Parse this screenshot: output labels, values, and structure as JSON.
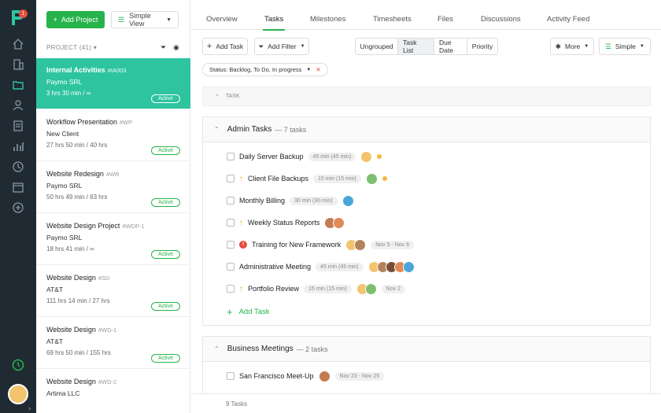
{
  "rail": {
    "logo_badge": "1",
    "icons": [
      "home-icon",
      "building-icon",
      "folder-icon",
      "user-icon",
      "invoice-icon",
      "reports-icon",
      "clock-icon",
      "calendar-icon",
      "add-circle-icon"
    ],
    "timer_icon": "timer-icon"
  },
  "projects_panel": {
    "add_project_label": "Add Project",
    "view_label": "Simple View",
    "header": "PROJECT (41)",
    "items": [
      {
        "name": "Internal Activities",
        "code": "#IA003",
        "client": "Paymo SRL",
        "time": "3 hrs 30 min / ∞",
        "status": "Active",
        "active": true
      },
      {
        "name": "Workflow Presentation",
        "code": "#WP",
        "client": "New Client",
        "time": "27 hrs 50 min / 40 hrs",
        "status": "Active",
        "active": false
      },
      {
        "name": "Website Redesign",
        "code": "#WR",
        "client": "Paymo SRL",
        "time": "50 hrs 49 min / 63 hrs",
        "status": "Active",
        "active": false
      },
      {
        "name": "Website Design Project",
        "code": "#WDP-1",
        "client": "Paymo SRL",
        "time": "18 hrs 41 min / ∞",
        "status": "Active",
        "active": false
      },
      {
        "name": "Website Design",
        "code": "#SD",
        "client": "AT&T",
        "time": "111 hrs 14 min / 27 hrs",
        "status": "Active",
        "active": false
      },
      {
        "name": "Website Design",
        "code": "#WD-1",
        "client": "AT&T",
        "time": "69 hrs 50 min / 155 hrs",
        "status": "Active",
        "active": false
      },
      {
        "name": "Website Design",
        "code": "#WD-2",
        "client": "Artima LLC",
        "time": "",
        "status": "",
        "active": false
      }
    ]
  },
  "tabs": [
    "Overview",
    "Tasks",
    "Milestones",
    "Timesheets",
    "Files",
    "Discussions",
    "Activity Feed"
  ],
  "active_tab": "Tasks",
  "toolbar": {
    "add_task": "Add Task",
    "add_filter": "Add Filter",
    "segments": [
      "Ungrouped",
      "Task List",
      "Due Date",
      "Priority"
    ],
    "active_segment": "Task List",
    "more": "More",
    "simple": "Simple"
  },
  "filter_chip": {
    "label": "Status: Backlog, To Do, In progress"
  },
  "task_header": "TASK",
  "groups": [
    {
      "name": "Admin Tasks",
      "count": "— 7 tasks",
      "tasks": [
        {
          "name": "Daily Server Backup",
          "pill": "45 min (45 min)",
          "prio": "",
          "avatars": [
            "#f2c46d"
          ],
          "dot": true
        },
        {
          "name": "Client File Backups",
          "pill": "15 min (15 min)",
          "prio": "↑",
          "avatars": [
            "#7dbf6e"
          ],
          "dot": true
        },
        {
          "name": "Monthly Billing",
          "pill": "30 min (30 min)",
          "prio": "",
          "avatars": [
            "#4aa6d8"
          ],
          "dot": false
        },
        {
          "name": "Weekly Status Reports",
          "pill": "",
          "prio": "↑",
          "avatars": [
            "#c47b52",
            "#e08a5a"
          ],
          "dot": false
        },
        {
          "name": "Training for New Framework",
          "pill": "Nov 5 - Nov 6",
          "prio": "!",
          "avatars": [
            "#f2c46d",
            "#b5835a"
          ],
          "dot": false
        },
        {
          "name": "Administrative Meeting",
          "pill": "45 min (45 min)",
          "prio": "",
          "avatars": [
            "#f2c46d",
            "#b5835a",
            "#7a4e35",
            "#e08a5a",
            "#4aa6d8"
          ],
          "dot": false
        },
        {
          "name": "Portfolio Review",
          "pill": "15 min (15 min)",
          "prio": "↑",
          "avatars": [
            "#f2c46d",
            "#7dbf6e"
          ],
          "pill2": "Nov 2",
          "dot": false
        }
      ],
      "add_task": "Add Task"
    },
    {
      "name": "Business Meetings",
      "count": "— 2 tasks",
      "tasks": [
        {
          "name": "San Francisco Meet-Up",
          "pill": "Nov 23 - Nov 25",
          "prio": "",
          "avatars": [
            "#c47b52"
          ],
          "dot": false
        }
      ]
    }
  ],
  "footer": "9 Tasks"
}
